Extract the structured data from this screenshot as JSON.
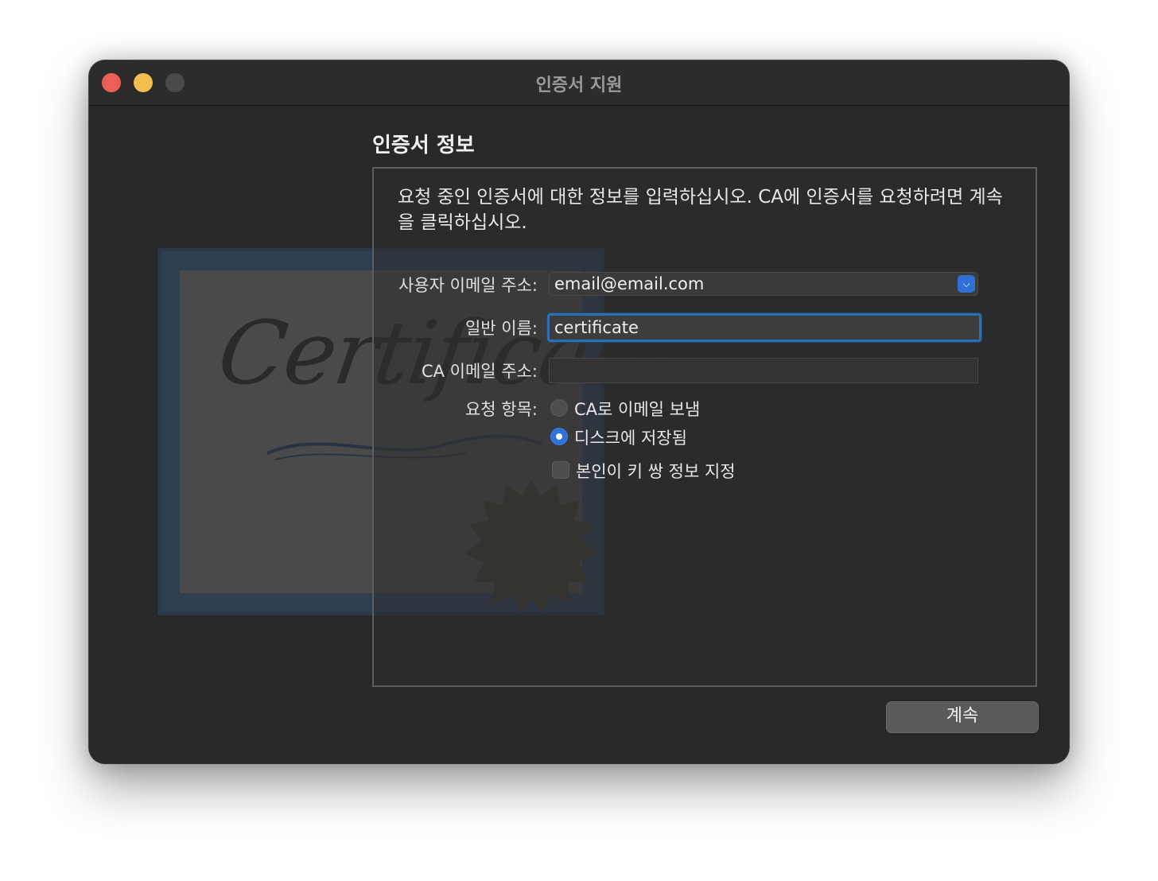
{
  "window": {
    "title": "인증서 지원"
  },
  "section_title": "인증서 정보",
  "description": "요청 중인 인증서에 대한 정보를 입력하십시오. CA에 인증서를 요청하려면 계속을 클릭하십시오.",
  "artwork": {
    "word": "Certificate"
  },
  "form": {
    "user_email_label": "사용자 이메일 주소:",
    "user_email_value": "email@email.com",
    "common_name_label": "일반 이름:",
    "common_name_value": "certificate",
    "ca_email_label": "CA 이메일 주소:",
    "ca_email_value": "",
    "request_label": "요청 항목:",
    "option_email_ca": "CA로 이메일 보냄",
    "option_save_disk": "디스크에 저장됨",
    "option_keypair": "본인이 키 쌍 정보 지정",
    "selected_option": "디스크에 저장됨",
    "keypair_checked": false
  },
  "buttons": {
    "continue": "계속"
  },
  "colors": {
    "close": "#ed5f56",
    "minimize": "#f4bf4f",
    "accent": "#2f72db",
    "window_bg": "#282828"
  }
}
